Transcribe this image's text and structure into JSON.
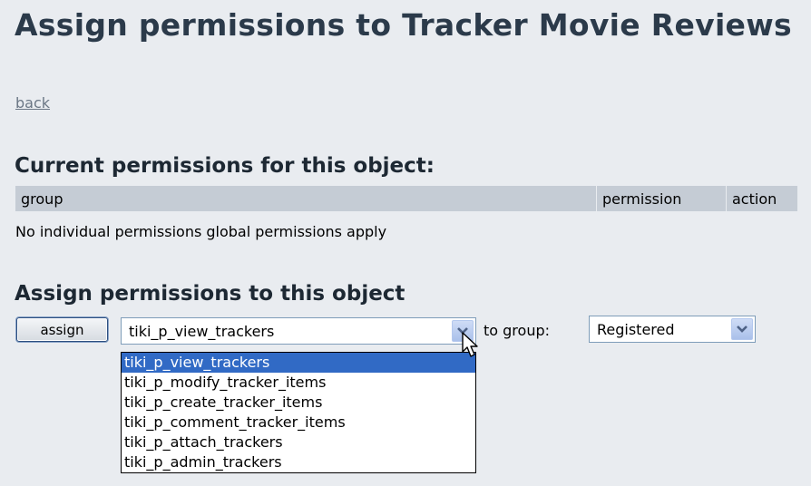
{
  "page": {
    "title": "Assign permissions to Tracker Movie Reviews",
    "back_link": "back"
  },
  "current_permissions": {
    "heading": "Current permissions for this object:",
    "columns": [
      "group",
      "permission",
      "action"
    ],
    "empty_message": "No individual permissions global permissions apply"
  },
  "assign": {
    "heading": "Assign permissions to this object",
    "button_label": "assign",
    "permission_select": {
      "value": "tiki_p_view_trackers",
      "options": [
        "tiki_p_view_trackers",
        "tiki_p_modify_tracker_items",
        "tiki_p_create_tracker_items",
        "tiki_p_comment_tracker_items",
        "tiki_p_attach_trackers",
        "tiki_p_admin_trackers"
      ],
      "highlighted_option": "tiki_p_view_trackers"
    },
    "to_group_label": "to group:",
    "group_select": {
      "value": "Registered"
    }
  },
  "colors": {
    "background": "#e9ecf0",
    "table_header": "#c5ccd5",
    "highlight": "#316ac5",
    "title": "#2b3a4a"
  }
}
